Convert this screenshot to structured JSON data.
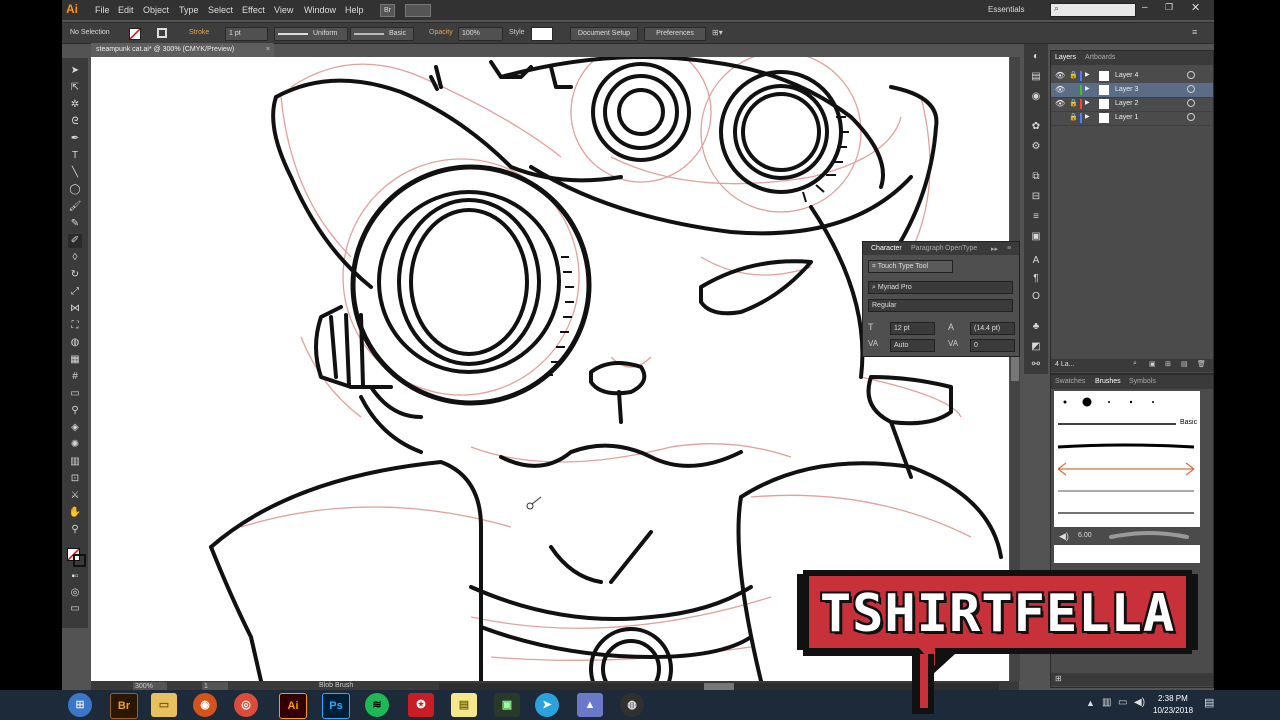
{
  "app": {
    "logo": "Ai",
    "menus": [
      "File",
      "Edit",
      "Object",
      "Type",
      "Select",
      "Effect",
      "View",
      "Window",
      "Help"
    ],
    "menu_badge": "Br",
    "workspace": "Essentials",
    "search_placeholder": ""
  },
  "control_bar": {
    "selection": "No Selection",
    "stroke_label": "Stroke",
    "stroke_value": "1 pt",
    "profile": "Uniform",
    "brush": "Basic",
    "opacity_label": "Opacity",
    "opacity_value": "100%",
    "style_label": "Style",
    "doc_setup": "Document Setup",
    "preferences": "Preferences"
  },
  "document": {
    "tab_title": "steampunk cat.ai* @ 300% (CMYK/Preview)"
  },
  "layers_panel": {
    "tabs": [
      "Layers",
      "Artboards"
    ],
    "layers": [
      {
        "name": "Layer 4",
        "color": "#4f7fff",
        "selected": false
      },
      {
        "name": "Layer 3",
        "color": "#3fbf3f",
        "selected": true
      },
      {
        "name": "Layer 2",
        "color": "#ff4040",
        "selected": false
      },
      {
        "name": "Layer 1",
        "color": "#4f7fff",
        "selected": false
      }
    ],
    "footer": "4 La..."
  },
  "character_panel": {
    "tabs": [
      "Character",
      "Paragraph",
      "OpenType"
    ],
    "touch_type": "Touch Type Tool",
    "font_family": "Myriad Pro",
    "font_style": "Regular",
    "size": "12 pt",
    "leading": "(14.4 pt)",
    "kerning": "Auto",
    "tracking": "0"
  },
  "brushes_panel": {
    "tabs": [
      "Swatches",
      "Brushes",
      "Symbols"
    ],
    "basic_label": "Basic",
    "brush_size": "6.00"
  },
  "statusbar": {
    "zoom": "300%",
    "artboard": "1",
    "tool": "Blob Brush"
  },
  "taskbar": {
    "time": "2:38 PM",
    "date": "10/23/2018",
    "icons": [
      "windows-start",
      "bridge",
      "file-explorer",
      "firefox",
      "chrome",
      "illustrator",
      "photoshop",
      "spotify",
      "game-app",
      "notes",
      "terminal",
      "telegram",
      "app-cone",
      "obs"
    ]
  },
  "watermark": {
    "text": "TSHIRTFELLA"
  },
  "colors": {
    "accent_orange": "#f7941d",
    "watermark_red": "#c8303a",
    "sketch_pink": "#e0a19b",
    "selection_blue": "#5a6c86"
  }
}
